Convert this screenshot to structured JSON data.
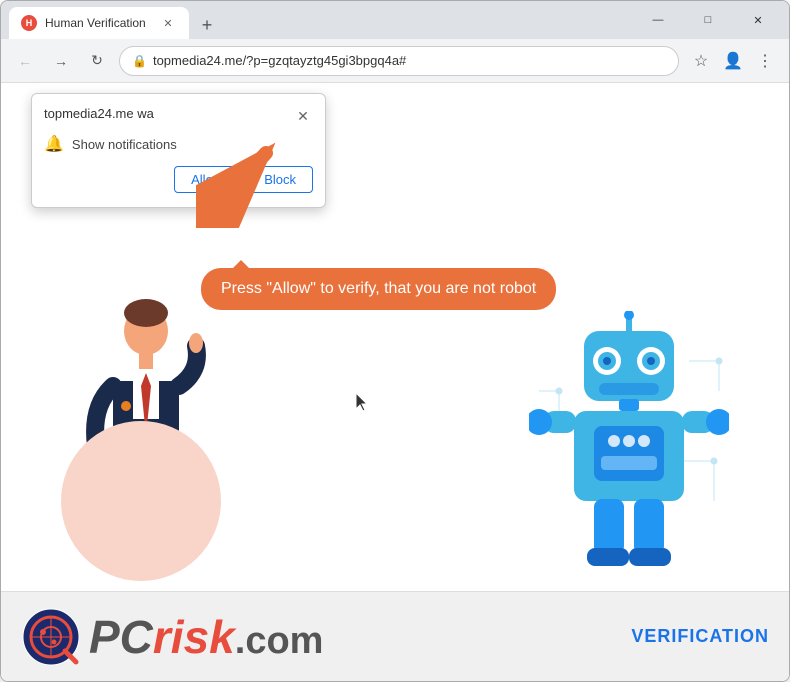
{
  "browser": {
    "tab_title": "Human Verification",
    "url": "topmedia24.me/?p=gzqtayztg45gi3bpgq4a#",
    "new_tab_label": "+",
    "window_controls": {
      "minimize": "—",
      "maximize": "□",
      "close": "✕"
    }
  },
  "notification_popup": {
    "site_text": "topmedia24.me wa",
    "close_icon": "✕",
    "bell_icon": "🔔",
    "message": "Show notifications",
    "allow_label": "Allow",
    "block_label": "Block"
  },
  "speech_bubble": {
    "text": "Press \"Allow\" to verify, that you are not robot"
  },
  "footer": {
    "logo_pc": "PC",
    "logo_risk": "risk",
    "logo_com": ".com",
    "verification_label": "VERIFICATION"
  },
  "icons": {
    "back": "←",
    "forward": "→",
    "refresh": "↻",
    "lock": "🔒",
    "star": "☆",
    "profile": "👤",
    "menu": "⋮"
  }
}
